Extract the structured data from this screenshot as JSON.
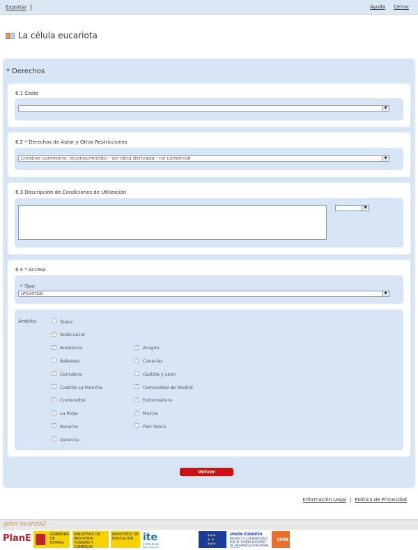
{
  "topbar": {
    "export": "Exportar",
    "help": "Ayuda",
    "close": "Cerrar"
  },
  "page": {
    "title": "La célula eucariota"
  },
  "section": {
    "title": "* Derechos"
  },
  "coste": {
    "title": "6.1 Coste",
    "value": ""
  },
  "derechos": {
    "title": "6.2 * Derechos de Autor y Otras Restricciones",
    "value": "creative commons: reconocimiento - sin obra derivada - no comercial"
  },
  "descripcion": {
    "title": "6.3 Descripción de Condiciones de Utilización",
    "text": "",
    "language": ""
  },
  "acceso": {
    "title": "6.4 * Acceso",
    "tipo_label": "* Tipo:",
    "tipo_value": "universal",
    "ambito_label": "Ámbito:",
    "options": [
      {
        "label": "Todos",
        "checked": false
      },
      {
        "label": "Nodo Local",
        "checked": true
      },
      {
        "label": "Andalucía",
        "checked": true
      },
      {
        "label": "Aragón",
        "checked": true
      },
      {
        "label": "Baleares",
        "checked": false
      },
      {
        "label": "Canarias",
        "checked": true
      },
      {
        "label": "Cantabria",
        "checked": true
      },
      {
        "label": "Castilla y León",
        "checked": false
      },
      {
        "label": "Castilla-La Mancha",
        "checked": false
      },
      {
        "label": "Comunidad de Madrid",
        "checked": true
      },
      {
        "label": "Contenidos",
        "checked": true
      },
      {
        "label": "Extremadura",
        "checked": true
      },
      {
        "label": "La Rioja",
        "checked": true
      },
      {
        "label": "Murcia",
        "checked": true
      },
      {
        "label": "Navarra",
        "checked": true
      },
      {
        "label": "País Vasco",
        "checked": false
      },
      {
        "label": "Valencia",
        "checked": true
      }
    ]
  },
  "actions": {
    "back": "Volver"
  },
  "footer": {
    "legal": "Información Legal",
    "privacy": "Política de Privacidad",
    "plan_brand": "plan avanza2",
    "logos": {
      "plane": "PlanE",
      "gobierno": "GOBIERNO DE ESPAÑA",
      "industria": "MINISTERIO DE INDUSTRIA, TURISMO Y COMERCIO",
      "educacion": "MINISTERIO DE EDUCACIÓN",
      "ite": "ite",
      "ite_sub": "Instituto de Tecnologías Educativas",
      "ue": "UNIÓN EUROPEA",
      "feder": "PROYECTO COFINANCIADO POR EL FONDO EUROPEO DE DESARROLLO REGIONAL (FEDER)",
      "year": "2008"
    }
  },
  "colors": {
    "panel": "#d8e5f5",
    "button": "#cc1111"
  }
}
